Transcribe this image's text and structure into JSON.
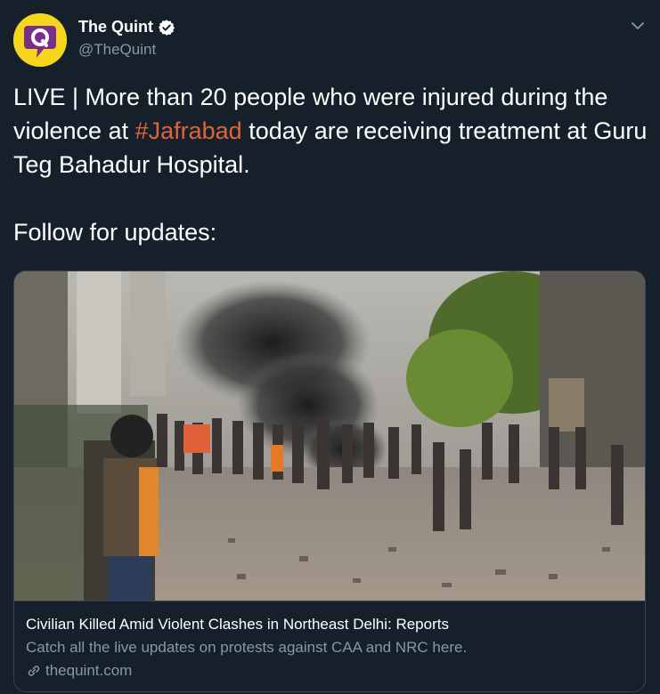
{
  "account": {
    "display_name": "The Quint",
    "handle": "@TheQuint",
    "avatar_letter": "Q",
    "avatar_color": "#f5d61c",
    "avatar_icon": "quint-logo"
  },
  "tweet": {
    "text_before": "LIVE | More than 20 people who were injured during the violence at ",
    "hashtag": "#Jafrabad",
    "text_after": " today are receiving treatment at Guru Teg Bahadur Hospital.\n\nFollow for updates:"
  },
  "card": {
    "image_description_icon": "news-photo",
    "title": "Civilian Killed Amid Violent Clashes in Northeast Delhi: Reports",
    "description": "Catch all the live updates on protests against CAA and NRC here.",
    "domain": "thequint.com"
  },
  "colors": {
    "background": "#15202b",
    "hashtag": "#e0633a",
    "secondary_text": "#8899a6",
    "border": "#38444d",
    "verified": "#ffffff"
  }
}
